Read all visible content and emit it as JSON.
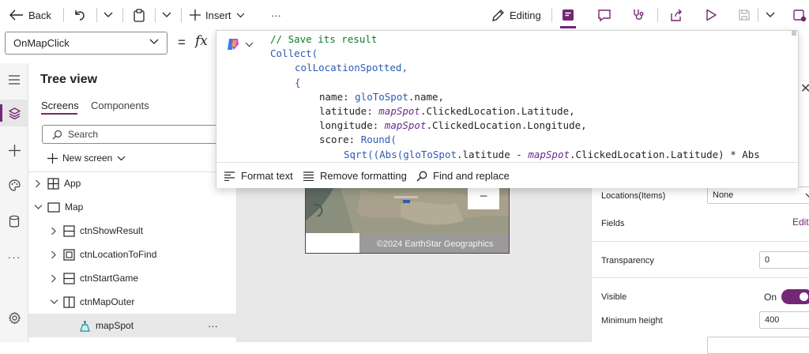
{
  "toolbar": {
    "back_label": "Back",
    "insert_label": "Insert",
    "more_label": "···",
    "editing_label": "Editing"
  },
  "formula": {
    "property": "OnMapClick",
    "equals": "=",
    "fx": "fx",
    "code_lines": [
      {
        "parts": [
          {
            "t": "// Save its result",
            "c": "comment"
          }
        ],
        "indent": 0
      },
      {
        "parts": [
          {
            "t": "Collect(",
            "c": "fn"
          }
        ],
        "indent": 0
      },
      {
        "parts": [
          {
            "t": "colLocationSpotted,",
            "c": "fn"
          }
        ],
        "indent": 1
      },
      {
        "parts": [
          {
            "t": "{",
            "c": "fn"
          }
        ],
        "indent": 1
      },
      {
        "parts": [
          {
            "t": "name: ",
            "c": ""
          },
          {
            "t": "gloToSpot",
            "c": "glob"
          },
          {
            "t": ".name,",
            "c": ""
          }
        ],
        "indent": 2
      },
      {
        "parts": [
          {
            "t": "latitude: ",
            "c": ""
          },
          {
            "t": "mapSpot",
            "c": "ctl"
          },
          {
            "t": ".ClickedLocation.Latitude,",
            "c": ""
          }
        ],
        "indent": 2
      },
      {
        "parts": [
          {
            "t": "longitude: ",
            "c": ""
          },
          {
            "t": "mapSpot",
            "c": "ctl"
          },
          {
            "t": ".ClickedLocation.Longitude,",
            "c": ""
          }
        ],
        "indent": 2
      },
      {
        "parts": [
          {
            "t": "score: ",
            "c": ""
          },
          {
            "t": "Round(",
            "c": "fn"
          }
        ],
        "indent": 2
      },
      {
        "parts": [
          {
            "t": "Sqrt((Abs(",
            "c": "fn"
          },
          {
            "t": "gloToSpot",
            "c": "glob"
          },
          {
            "t": ".latitude - ",
            "c": ""
          },
          {
            "t": "mapSpot",
            "c": "ctl"
          },
          {
            "t": ".ClickedLocation.Latitude) * Abs",
            "c": ""
          }
        ],
        "indent": 3
      }
    ],
    "format_text_label": "Format text",
    "remove_formatting_label": "Remove formatting",
    "find_replace_label": "Find and replace"
  },
  "tree": {
    "title": "Tree view",
    "tabs": [
      "Screens",
      "Components"
    ],
    "search_placeholder": "Search",
    "new_screen_label": "New screen",
    "rows": [
      {
        "label": "App",
        "indent": 0,
        "chevron": "right",
        "icon": "app-icon"
      },
      {
        "label": "Map",
        "indent": 0,
        "chevron": "down",
        "icon": "screen-icon"
      },
      {
        "label": "ctnShowResult",
        "indent": 1,
        "chevron": "right",
        "icon": "vertical-container-icon"
      },
      {
        "label": "ctnLocationToFind",
        "indent": 1,
        "chevron": "right",
        "icon": "container-icon"
      },
      {
        "label": "ctnStartGame",
        "indent": 1,
        "chevron": "right",
        "icon": "vertical-container-icon"
      },
      {
        "label": "ctnMapOuter",
        "indent": 1,
        "chevron": "down",
        "icon": "horizontal-container-icon"
      },
      {
        "label": "mapSpot",
        "indent": 2,
        "chevron": "none",
        "icon": "map-pin-icon"
      }
    ],
    "row_more": "···"
  },
  "canvas": {
    "map_attribution": "©2024 EarthStar Geographics",
    "zoom_out": "−"
  },
  "props": {
    "locations_label": "Locations(Items)",
    "locations_value": "None",
    "fields_label": "Fields",
    "fields_link": "Edit",
    "transparency_label": "Transparency",
    "transparency_value": "0",
    "visible_label": "Visible",
    "visible_value": "On",
    "min_height_label": "Minimum height",
    "min_height_value": "400"
  },
  "colors": {
    "accent": "#742774",
    "comment": "#0a7b2a",
    "function": "#2d5ab4"
  }
}
